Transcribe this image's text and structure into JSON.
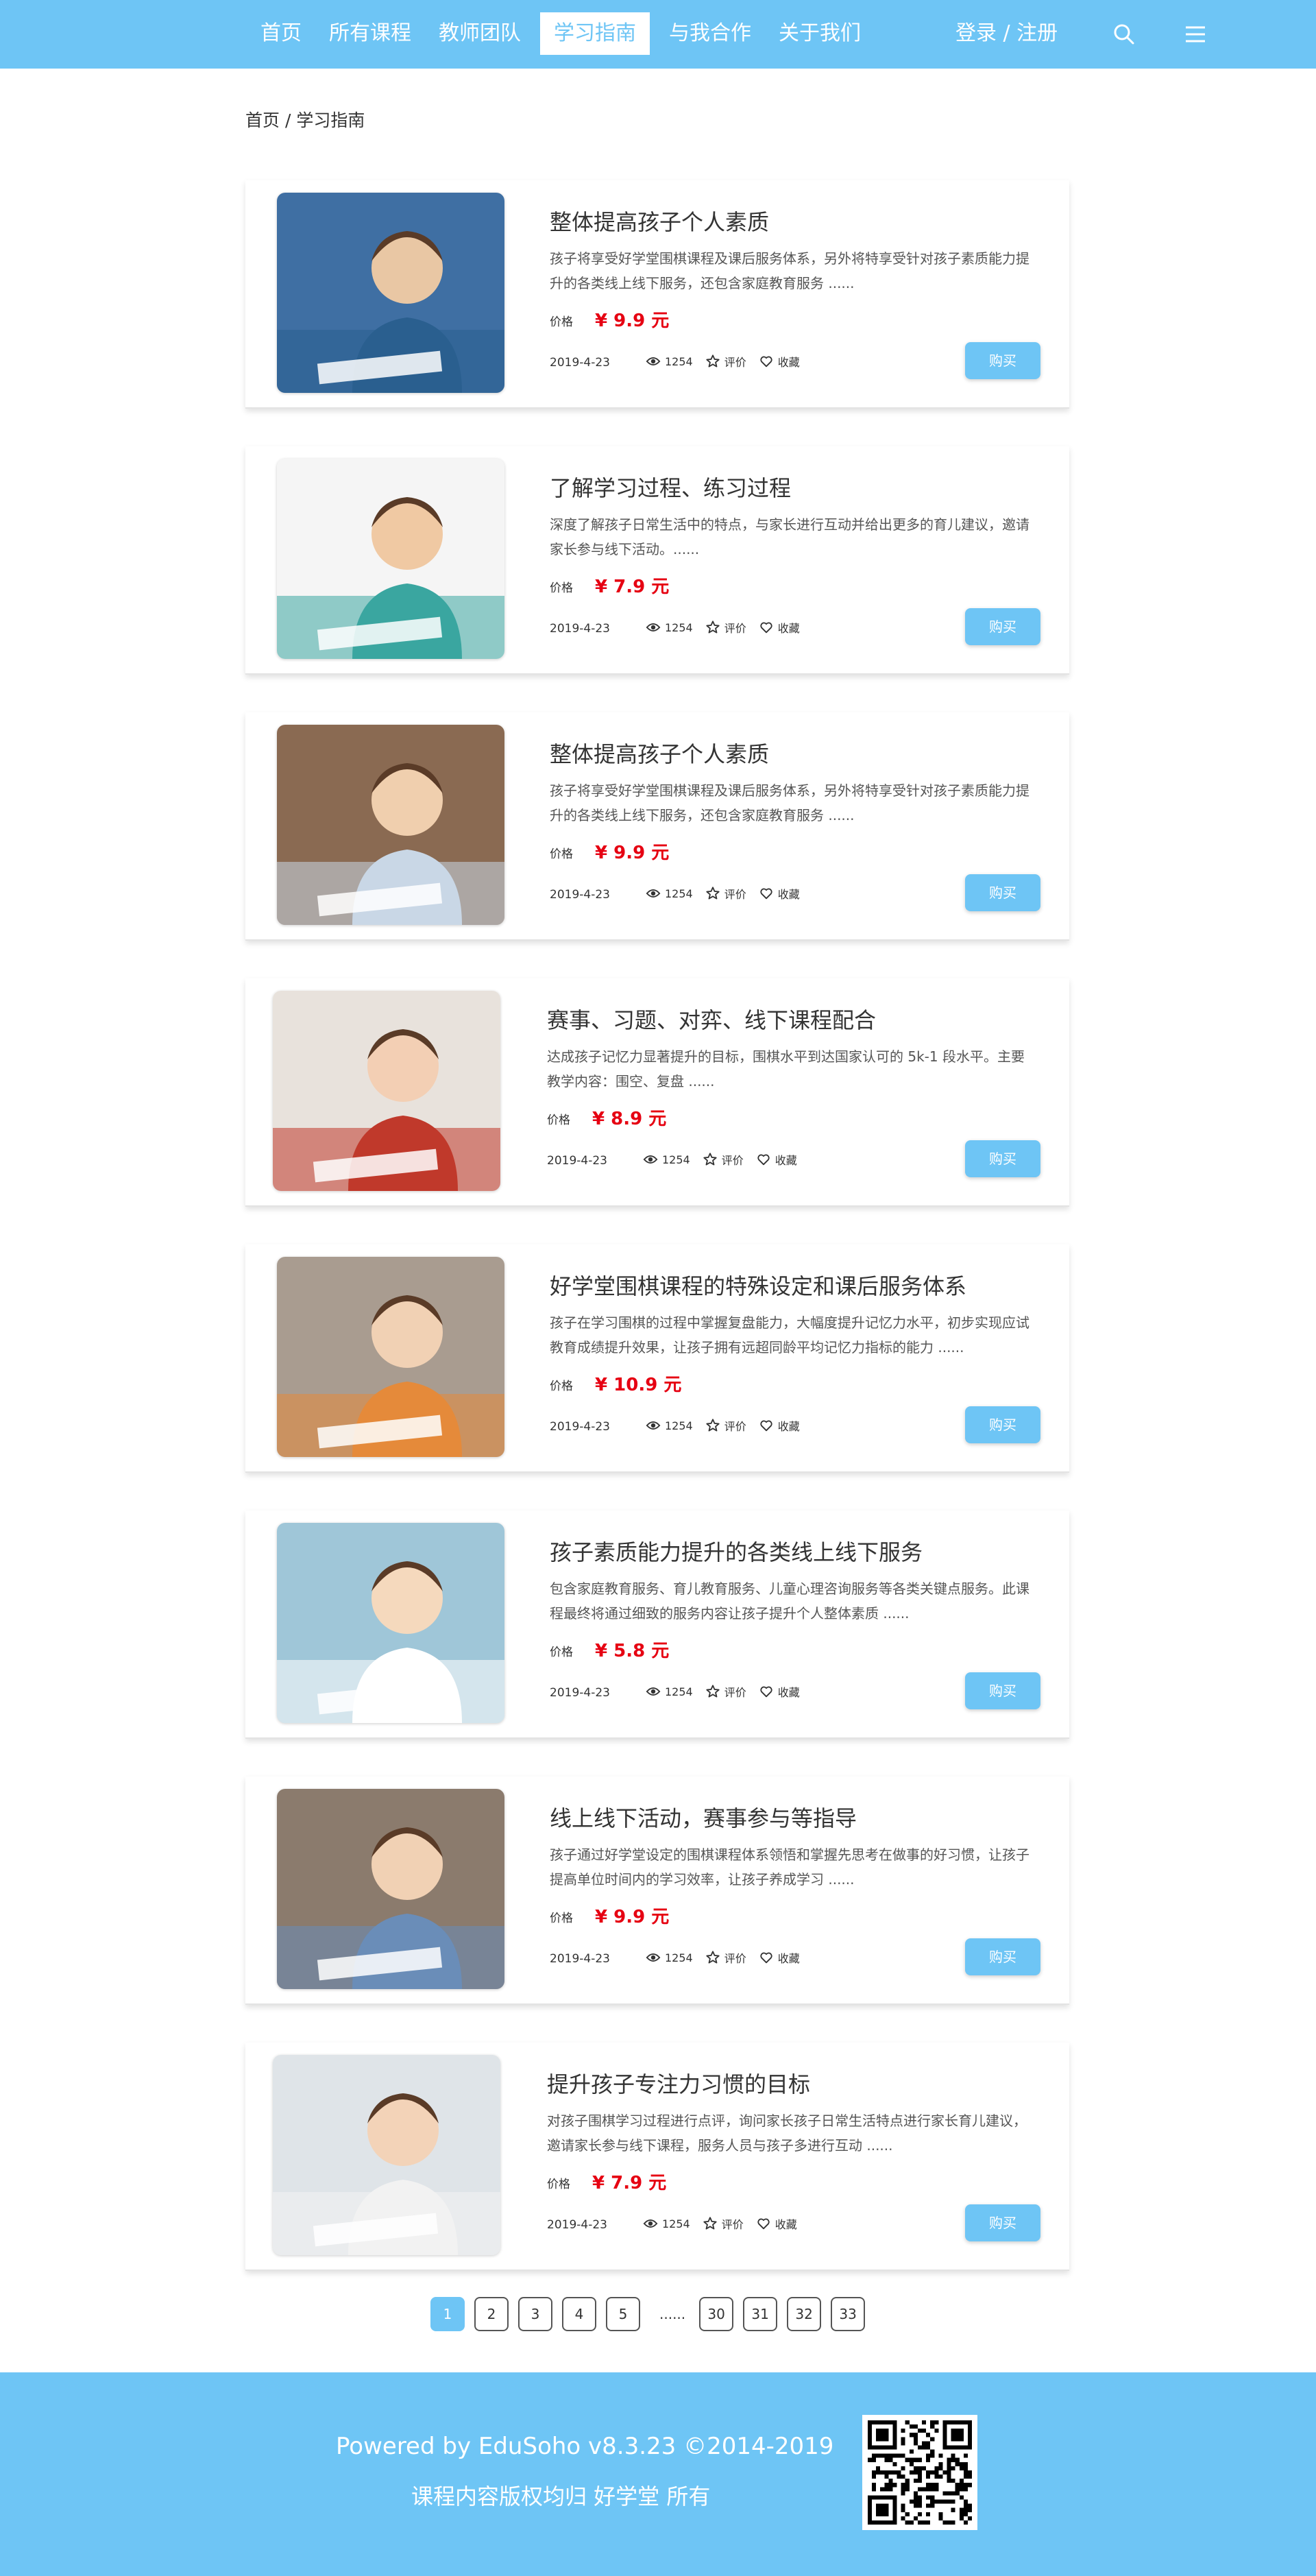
{
  "header": {
    "nav": [
      "首页",
      "所有课程",
      "教师团队",
      "学习指南",
      "与我合作",
      "关于我们"
    ],
    "active_nav": "学习指南",
    "login": "登录 / 注册",
    "icons": {
      "search": "search-icon",
      "menu": "hamburger-menu-icon"
    },
    "color": "#6ec5f5"
  },
  "breadcrumb": "首页 / 学习指南",
  "courses": [
    {
      "title": "整体提高孩子个人素质",
      "desc": "孩子将享受好学堂围棋课程及课后服务体系，另外将特享受针对孩子素质能力提升的各类线上线下服务，还包含家庭教育服务 ......",
      "price_label": "价格",
      "price": "¥  9.9 元",
      "date": "2019-4-23",
      "views": "1254",
      "rate": "评价",
      "fav": "收藏",
      "buy": "购买"
    },
    {
      "title": "了解学习过程、练习过程",
      "desc": "深度了解孩子日常生活中的特点，与家长进行互动并给出更多的育儿建议，邀请家长参与线下活动。......",
      "price_label": "价格",
      "price": "¥  7.9 元",
      "date": "2019-4-23",
      "views": "1254",
      "rate": "评价",
      "fav": "收藏",
      "buy": "购买"
    },
    {
      "title": "整体提高孩子个人素质",
      "desc": "孩子将享受好学堂围棋课程及课后服务体系，另外将特享受针对孩子素质能力提升的各类线上线下服务，还包含家庭教育服务 ......",
      "price_label": "价格",
      "price": "¥  9.9 元",
      "date": "2019-4-23",
      "views": "1254",
      "rate": "评价",
      "fav": "收藏",
      "buy": "购买"
    },
    {
      "title": "赛事、习题、对弈、线下课程配合",
      "desc": "达成孩子记忆力显著提升的目标，围棋水平到达国家认可的 5k-1 段水平。主要教学内容：围空、复盘 ......",
      "price_label": "价格",
      "price": "¥  8.9 元",
      "date": "2019-4-23",
      "views": "1254",
      "rate": "评价",
      "fav": "收藏",
      "buy": "购买"
    },
    {
      "title": "好学堂围棋课程的特殊设定和课后服务体系",
      "desc": "孩子在学习围棋的过程中掌握复盘能力，大幅度提升记忆力水平，初步实现应试教育成绩提升效果，让孩子拥有远超同龄平均记忆力指标的能力 ......",
      "price_label": "价格",
      "price": "¥  10.9 元",
      "date": "2019-4-23",
      "views": "1254",
      "rate": "评价",
      "fav": "收藏",
      "buy": "购买"
    },
    {
      "title": "孩子素质能力提升的各类线上线下服务",
      "desc": "包含家庭教育服务、育儿教育服务、儿童心理咨询服务等各类关键点服务。此课程最终将通过细致的服务内容让孩子提升个人整体素质 ......",
      "price_label": "价格",
      "price": "¥  5.8 元",
      "date": "2019-4-23",
      "views": "1254",
      "rate": "评价",
      "fav": "收藏",
      "buy": "购买"
    },
    {
      "title": "线上线下活动，赛事参与等指导",
      "desc": "孩子通过好学堂设定的围棋课程体系领悟和掌握先思考在做事的好习惯，让孩子提高单位时间内的学习效率，让孩子养成学习 ......",
      "price_label": "价格",
      "price": "¥  9.9 元",
      "date": "2019-4-23",
      "views": "1254",
      "rate": "评价",
      "fav": "收藏",
      "buy": "购买"
    },
    {
      "title": "提升孩子专注力习惯的目标",
      "desc": "对孩子围棋学习过程进行点评，询问家长孩子日常生活特点进行家长育儿建议，邀请家长参与线下课程，服务人员与孩子多进行互动 ......",
      "price_label": "价格",
      "price": "¥  7.9 元",
      "date": "2019-4-23",
      "views": "1254",
      "rate": "评价",
      "fav": "收藏",
      "buy": "购买"
    }
  ],
  "pagination": {
    "pages": [
      "1",
      "2",
      "3",
      "4",
      "5"
    ],
    "dots": "......",
    "tail": [
      "30",
      "31",
      "32",
      "33"
    ],
    "active": "1"
  },
  "footer": {
    "powered": "Powered by EduSoho v8.3.23 ©2014-2019",
    "copyright": "课程内容版权均归 好学堂 所有",
    "qr_icon": "qr-code-icon"
  }
}
